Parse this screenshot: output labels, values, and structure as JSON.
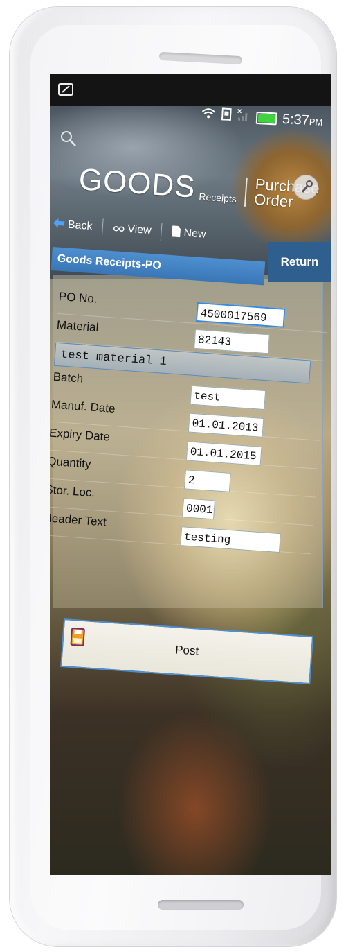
{
  "status_bar": {
    "time": "5:37",
    "ampm": "PM"
  },
  "header": {
    "brand_main": "GOODS",
    "brand_sub": "Receipts",
    "title": "Purchase Order"
  },
  "toolbar": {
    "back_label": "Back",
    "view_label": "View",
    "new_label": "New"
  },
  "panel": {
    "title": "Goods Receipts-PO",
    "return_label": "Return"
  },
  "form": {
    "po_no_label": "PO No.",
    "po_no_value": "4500017569",
    "material_label": "Material",
    "material_value": "82143",
    "material_description": "test material 1",
    "batch_label": "Batch",
    "batch_value": "test",
    "manuf_date_label": "Manuf. Date",
    "manuf_date_value": "01.01.2013",
    "expiry_date_label": "Expiry Date",
    "expiry_date_value": "01.01.2015",
    "quantity_label": "Quantity",
    "quantity_value": "2",
    "stor_loc_label": "Stor. Loc.",
    "stor_loc_value": "0001",
    "header_text_label": "Header Text",
    "header_text_value": "testing"
  },
  "actions": {
    "post_label": "Post"
  },
  "colors": {
    "accent": "#4e8fd0",
    "return_bg": "#2e5f8e"
  }
}
